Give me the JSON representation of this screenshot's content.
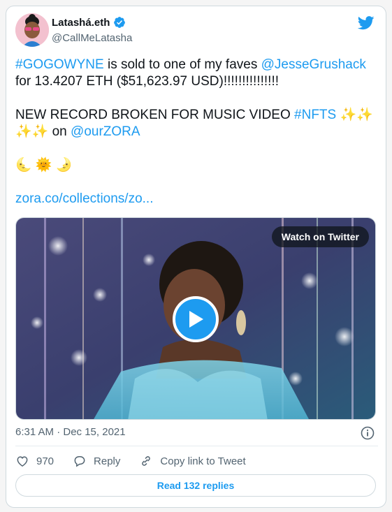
{
  "author": {
    "name": "Latashá.eth",
    "handle": "@CallMeLatasha",
    "verified": true
  },
  "tweet": {
    "line1": {
      "hashtag": "#GOGOWYNE",
      "mid": " is sold to one of my faves ",
      "mention": "@JesseGrushack"
    },
    "line2": "for 13.4207 ETH ($51,623.97 USD)!!!!!!!!!!!!!!!",
    "line3": {
      "text": "NEW RECORD BROKEN FOR MUSIC VIDEO ",
      "hashtag": "#NFTS",
      "emoji_a": " ✨✨"
    },
    "line4": {
      "emoji": "✨✨",
      "text": " on ",
      "mention": "@ourZORA"
    },
    "line5_emoji": "🌜 🌞 🌛",
    "link": "zora.co/collections/zo..."
  },
  "media": {
    "watch_label": "Watch on Twitter"
  },
  "meta": {
    "timestamp": "6:31 AM · Dec 15, 2021"
  },
  "actions": {
    "likes": "970",
    "reply_label": "Reply",
    "copy_label": "Copy link to Tweet"
  },
  "read_replies_label": "Read 132 replies",
  "colors": {
    "accent": "#1d9bf0",
    "text": "#0f1419",
    "muted": "#536471",
    "border": "#cfd9de"
  }
}
